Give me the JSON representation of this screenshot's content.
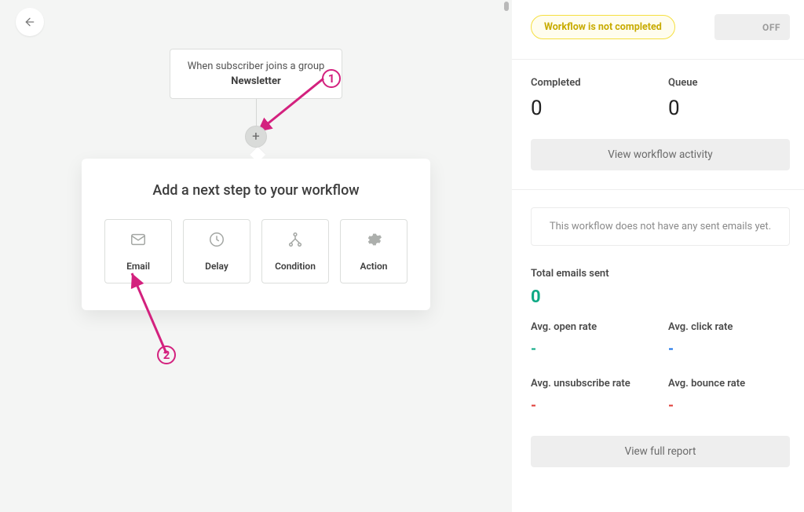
{
  "trigger": {
    "line1": "When subscriber joins a group",
    "line2": "Newsletter"
  },
  "step_panel": {
    "title": "Add a next step to your workflow",
    "options": [
      {
        "key": "email",
        "label": "Email"
      },
      {
        "key": "delay",
        "label": "Delay"
      },
      {
        "key": "condition",
        "label": "Condition"
      },
      {
        "key": "action",
        "label": "Action"
      }
    ]
  },
  "annotations": {
    "badge1": "1",
    "badge2": "2"
  },
  "sidebar": {
    "status_pill": "Workflow is not completed",
    "toggle_state": "OFF",
    "completed_label": "Completed",
    "completed_value": "0",
    "queue_label": "Queue",
    "queue_value": "0",
    "view_activity": "View workflow activity",
    "empty_emails_note": "This workflow does not have any sent emails yet.",
    "total_label": "Total emails sent",
    "total_value": "0",
    "open_label": "Avg. open rate",
    "open_value": "-",
    "click_label": "Avg. click rate",
    "click_value": "-",
    "unsub_label": "Avg. unsubscribe rate",
    "unsub_value": "-",
    "bounce_label": "Avg. bounce rate",
    "bounce_value": "-",
    "full_report": "View full report"
  }
}
